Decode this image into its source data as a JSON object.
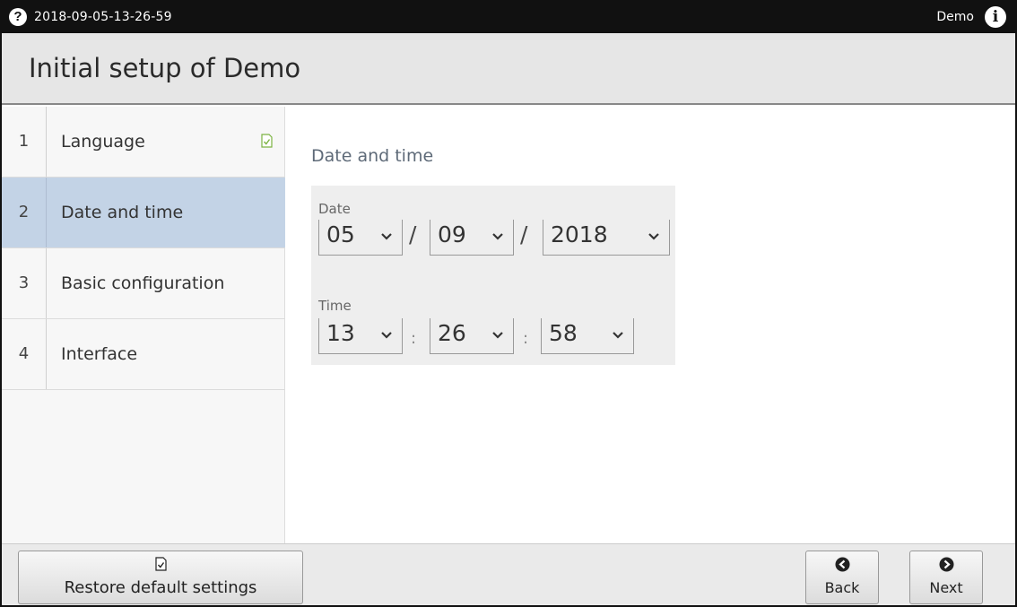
{
  "statusbar": {
    "help_glyph": "?",
    "timestamp": "2018-09-05-13-26-59",
    "user": "Demo",
    "info_glyph": "i"
  },
  "header": {
    "title": "Initial setup of Demo"
  },
  "sidebar": {
    "steps": [
      {
        "number": "1",
        "label": "Language",
        "completed": true
      },
      {
        "number": "2",
        "label": "Date and time",
        "active": true
      },
      {
        "number": "3",
        "label": "Basic configuration"
      },
      {
        "number": "4",
        "label": "Interface"
      }
    ]
  },
  "main": {
    "section_title": "Date and time",
    "date": {
      "label": "Date",
      "day": "05",
      "month": "09",
      "year": "2018",
      "separator": "/"
    },
    "time": {
      "label": "Time",
      "hour": "13",
      "minute": "26",
      "second": "58",
      "separator": ":"
    }
  },
  "footer": {
    "restore_label": "Restore default settings",
    "back_label": "Back",
    "next_label": "Next"
  },
  "icons": {
    "help": "help-circle-icon",
    "info": "info-circle-icon",
    "check": "document-check-icon",
    "chevron": "chevron-down-icon",
    "back": "arrow-left-circle-icon",
    "next": "arrow-right-circle-icon"
  },
  "colors": {
    "statusbar_bg": "#111111",
    "active_step_bg": "#c3d3e6",
    "check_green": "#7cb342",
    "section_title": "#5e6a78"
  }
}
